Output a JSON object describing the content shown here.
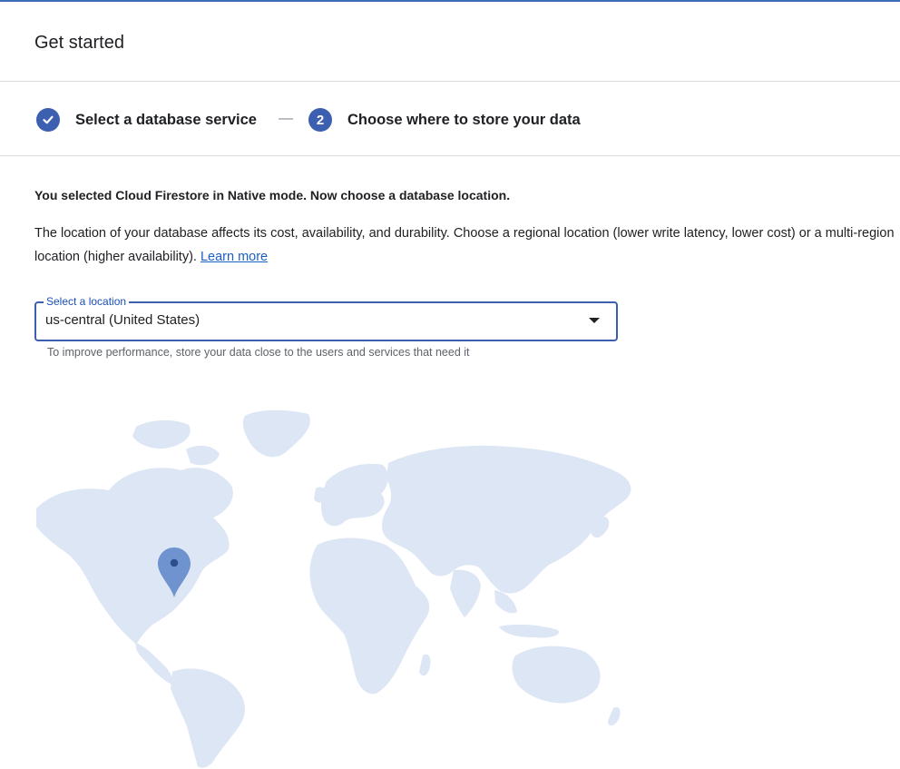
{
  "header": {
    "title": "Get started"
  },
  "stepper": {
    "step1": {
      "label": "Select a database service",
      "state": "completed",
      "icon": "check-icon"
    },
    "separator": "—",
    "step2": {
      "number": "2",
      "label": "Choose where to store your data",
      "state": "active"
    }
  },
  "content": {
    "lead": "You selected Cloud Firestore in Native mode. Now choose a database location.",
    "description": "The location of your database affects its cost, availability, and durability. Choose a regional location (lower write latency, lower cost) or a multi-region location (higher availability).",
    "learn_more": "Learn more"
  },
  "location_select": {
    "label": "Select a location",
    "value": "us-central (United States)",
    "hint": "To improve performance, store your data close to the users and services that need it"
  },
  "map": {
    "marker_region": "us-central",
    "marker_icon": "map-pin-icon"
  },
  "colors": {
    "accent": "#3c5fb0",
    "map_land": "#dce6f4",
    "marker": "#6f93cf",
    "link": "#1a5fc8"
  }
}
